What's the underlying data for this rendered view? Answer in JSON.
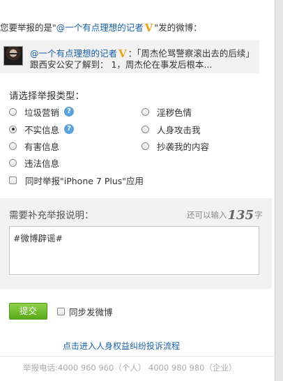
{
  "header": {
    "prefix": "您要举报的是\"",
    "user": "@一个有点理想的记者",
    "vip": "V",
    "suffix": "\"发的微博："
  },
  "quoted_post": {
    "author": "@一个有点理想的记者",
    "vip": "V",
    "line1_text": "：「周杰伦骂警察滚出去的后续」",
    "line2_text": "跟西安公安了解到： 1，周杰伦在事发后根本..."
  },
  "report_type": {
    "title": "请选择举报类型：",
    "options": [
      {
        "label": "垃圾营销",
        "help": "?",
        "checked": false
      },
      {
        "label": "淫秽色情",
        "checked": false
      },
      {
        "label": "不实信息",
        "help": "?",
        "checked": true
      },
      {
        "label": "人身攻击我",
        "checked": false
      },
      {
        "label": "有害信息",
        "checked": false
      },
      {
        "label": "抄袭我的内容",
        "checked": false
      },
      {
        "label": "违法信息",
        "checked": false
      }
    ],
    "also_report": "同时举报\"iPhone 7 Plus\"应用"
  },
  "description": {
    "title": "需要补充举报说明：",
    "remain_prefix": "还可以输入",
    "remain_count": "135",
    "remain_suffix": "字",
    "value": "#微博辟谣#"
  },
  "actions": {
    "submit_label": "提交",
    "sync_label": "同步发微博"
  },
  "link_text": "点击进入人身权益纠纷投诉流程",
  "footer_text": "举报电话:4000 960 960（个人） 4000 980 980（企业）",
  "colors": {
    "link_blue": "#1a5fa8",
    "vip_gold": "#e8a317",
    "submit_green": "#6fbb2c",
    "help_blue": "#5aa2dc"
  }
}
